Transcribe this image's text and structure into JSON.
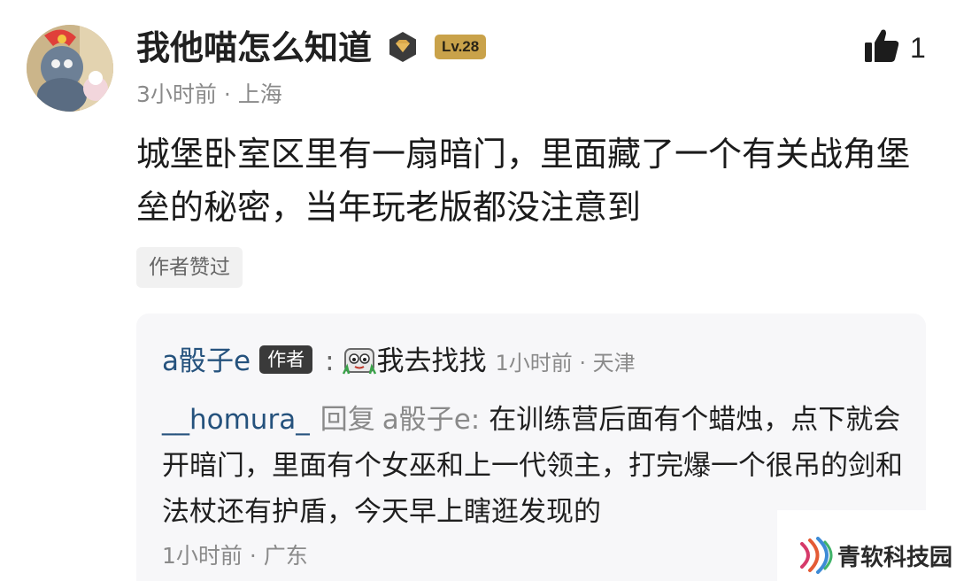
{
  "post": {
    "username": "我他喵怎么知道",
    "level": "Lv.28",
    "like_count": "1",
    "meta": "3小时前 · 上海",
    "content": "城堡卧室区里有一扇暗门，里面藏了一个有关战角堡垒的秘密，当年玩老版都没注意到",
    "author_liked_tag": "作者赞过"
  },
  "replies": {
    "first": {
      "user": "a骰子e",
      "author_tag": "作者",
      "colon": ":",
      "text": "我去找找",
      "time": "1小时前 · 天津"
    },
    "second": {
      "user": "__homura_",
      "reply_word": "回复",
      "target": "a骰子e",
      "colon": ":",
      "text": "在训练营后面有个蜡烛，点下就会开暗门，里面有个女巫和上一代领主，打完爆一个很吊的剑和法杖还有护盾，今天早上瞎逛发现的",
      "meta": "1小时前 · 广东"
    }
  },
  "watermark": {
    "text": "青软科技园"
  },
  "icons": {
    "badge": "diamond-badge-icon",
    "like": "thumbs-up-icon",
    "emoji": "peeking-frog-emoji-icon",
    "watermark": "sound-wave-logo-icon"
  },
  "colors": {
    "level_badge": "#c9a24a",
    "link_user": "#25527d",
    "reply_box_bg": "#f7f7f9"
  }
}
